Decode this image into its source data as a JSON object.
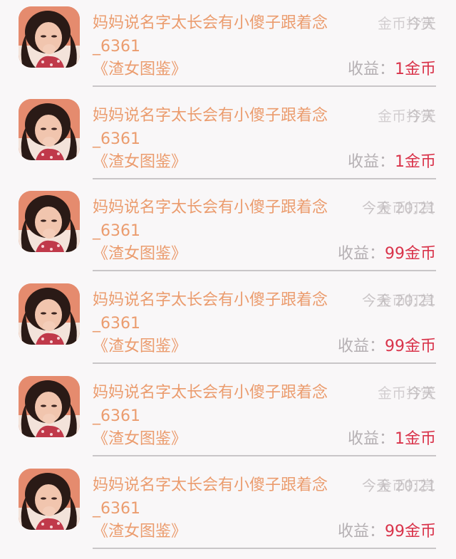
{
  "rows": [
    {
      "avatar": "user-avatar",
      "name": "妈妈说名字太长会有小傻子跟着念_6361",
      "meta_a": "今天",
      "meta_b": "金币打赏",
      "book": "《渣女图鉴》",
      "income_label": "收益：",
      "income_value": "1金币"
    },
    {
      "avatar": "user-avatar",
      "name": "妈妈说名字太长会有小傻子跟着念_6361",
      "meta_a": "今天",
      "meta_b": "金币打赏",
      "book": "《渣女图鉴》",
      "income_label": "收益：",
      "income_value": "1金币"
    },
    {
      "avatar": "user-avatar",
      "name": "妈妈说名字太长会有小傻子跟着念_6361",
      "meta_a": "今天 20:21",
      "meta_b": "金币打赏",
      "book": "《渣女图鉴》",
      "income_label": "收益：",
      "income_value": "99金币"
    },
    {
      "avatar": "user-avatar",
      "name": "妈妈说名字太长会有小傻子跟着念_6361",
      "meta_a": "今天 20:21",
      "meta_b": "金币打赏",
      "book": "《渣女图鉴》",
      "income_label": "收益：",
      "income_value": "99金币"
    },
    {
      "avatar": "user-avatar",
      "name": "妈妈说名字太长会有小傻子跟着念_6361",
      "meta_a": "今天",
      "meta_b": "金币打赏",
      "book": "《渣女图鉴》",
      "income_label": "收益：",
      "income_value": "1金币"
    },
    {
      "avatar": "user-avatar",
      "name": "妈妈说名字太长会有小傻子跟着念_6361",
      "meta_a": "今天 20:21",
      "meta_b": "金币打赏",
      "book": "《渣女图鉴》",
      "income_label": "收益：",
      "income_value": "99金币"
    }
  ],
  "colors": {
    "background": "#f9f7f8",
    "name_text": "#eb9c6e",
    "income_value": "#d9334a",
    "muted_text": "#b5b0b3",
    "divider": "#c9c6c8"
  }
}
